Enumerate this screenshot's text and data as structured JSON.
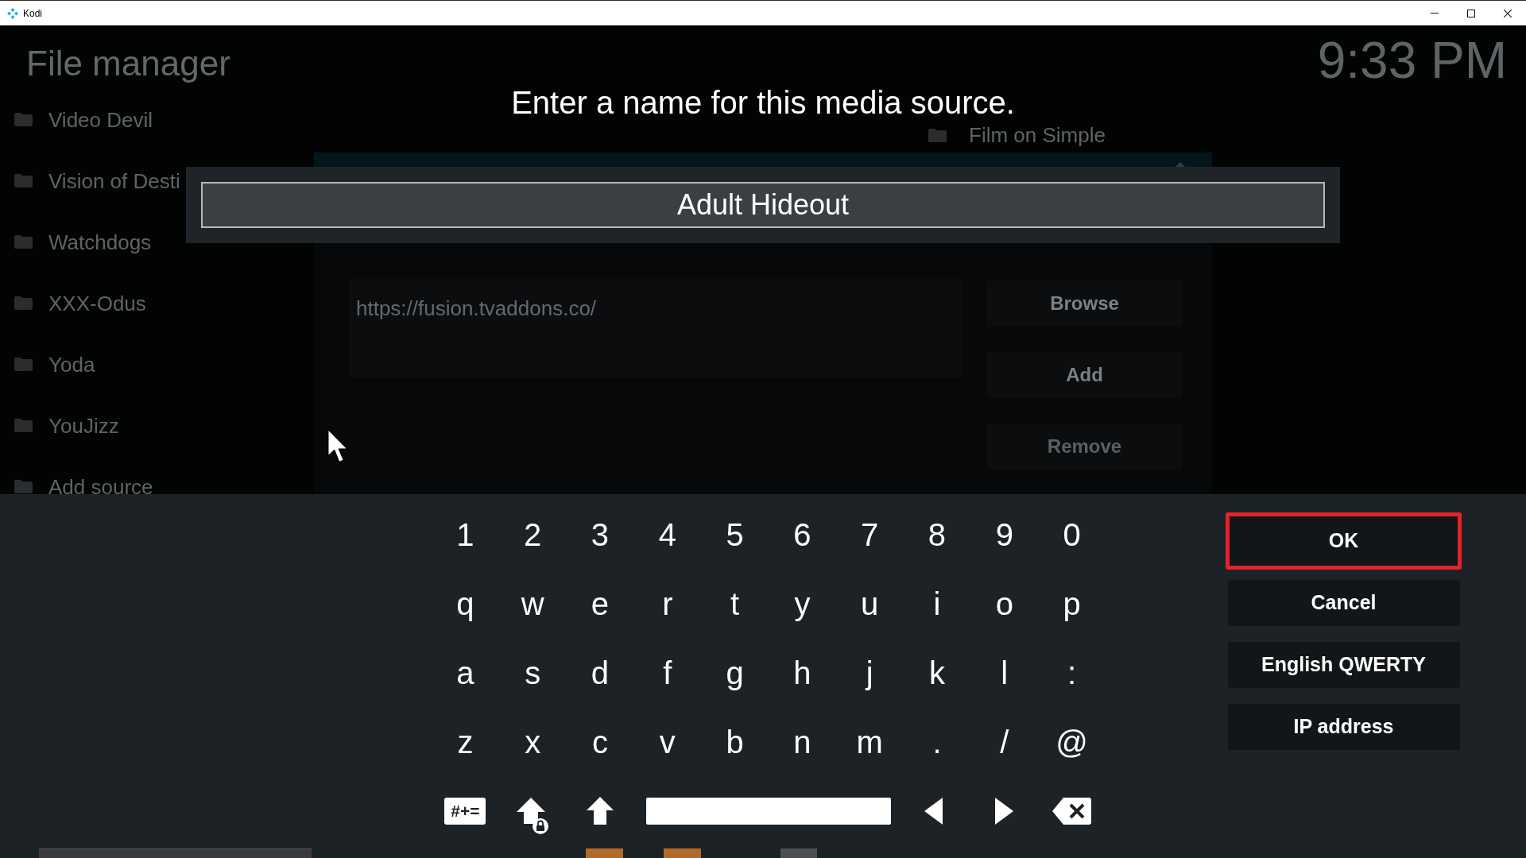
{
  "window": {
    "title": "Kodi"
  },
  "file_manager": {
    "title": "File manager",
    "clock": "9:33 PM",
    "left_sources": [
      {
        "label": "Video Devil"
      },
      {
        "label": "Vision of Desti"
      },
      {
        "label": "Watchdogs"
      },
      {
        "label": "XXX-Odus"
      },
      {
        "label": "Yoda"
      },
      {
        "label": "YouJizz"
      },
      {
        "label": "Add source"
      }
    ],
    "right_sources": [
      {
        "label": "Film on Simple"
      }
    ]
  },
  "add_source_dialog": {
    "path": "https://fusion.tvaddons.co/",
    "buttons": [
      {
        "label": "Browse",
        "disabled": false
      },
      {
        "label": "Add",
        "disabled": false
      },
      {
        "label": "Remove",
        "disabled": true
      }
    ]
  },
  "keyboard_dialog": {
    "heading": "Enter a name for this media source.",
    "value": "Adult Hideout"
  },
  "keyboard": {
    "rows": [
      [
        "1",
        "2",
        "3",
        "4",
        "5",
        "6",
        "7",
        "8",
        "9",
        "0"
      ],
      [
        "q",
        "w",
        "e",
        "r",
        "t",
        "y",
        "u",
        "i",
        "o",
        "p"
      ],
      [
        "a",
        "s",
        "d",
        "f",
        "g",
        "h",
        "j",
        "k",
        "l",
        ":"
      ],
      [
        "z",
        "x",
        "c",
        "v",
        "b",
        "n",
        "m",
        ".",
        "/",
        "@"
      ]
    ],
    "bottom_row": [
      {
        "kind": "symbols",
        "label": "#+="
      },
      {
        "kind": "caps_lock"
      },
      {
        "kind": "shift"
      },
      {
        "kind": "space"
      },
      {
        "kind": "left"
      },
      {
        "kind": "right"
      },
      {
        "kind": "backspace"
      }
    ]
  },
  "actions": [
    {
      "label": "OK",
      "selected": true
    },
    {
      "label": "Cancel",
      "selected": false
    },
    {
      "label": "English QWERTY",
      "selected": false
    },
    {
      "label": "IP address",
      "selected": false
    }
  ]
}
